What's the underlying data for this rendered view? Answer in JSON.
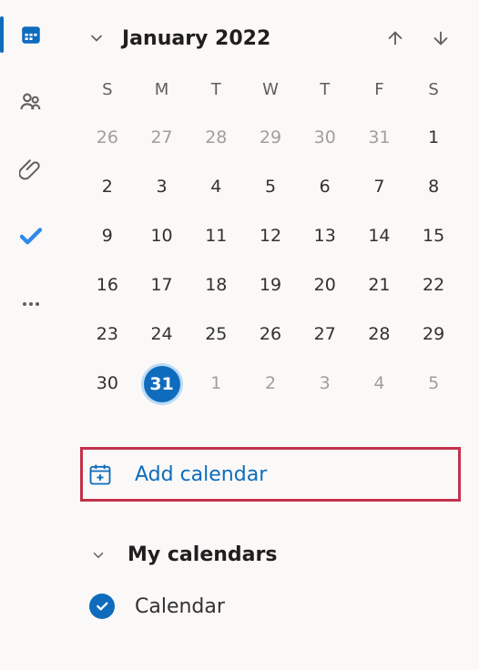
{
  "colors": {
    "accent": "#0f6cbd",
    "highlight": "#c4314b"
  },
  "rail": {
    "items": [
      {
        "name": "calendar",
        "active": true
      },
      {
        "name": "people",
        "active": false
      },
      {
        "name": "files",
        "active": false
      },
      {
        "name": "todo",
        "active": false
      },
      {
        "name": "more",
        "active": false
      }
    ]
  },
  "calendar": {
    "title": "January 2022",
    "dow": [
      "S",
      "M",
      "T",
      "W",
      "T",
      "F",
      "S"
    ],
    "weeks": [
      [
        {
          "d": "26",
          "adj": true
        },
        {
          "d": "27",
          "adj": true
        },
        {
          "d": "28",
          "adj": true
        },
        {
          "d": "29",
          "adj": true
        },
        {
          "d": "30",
          "adj": true
        },
        {
          "d": "31",
          "adj": true
        },
        {
          "d": "1"
        }
      ],
      [
        {
          "d": "2"
        },
        {
          "d": "3"
        },
        {
          "d": "4"
        },
        {
          "d": "5"
        },
        {
          "d": "6"
        },
        {
          "d": "7"
        },
        {
          "d": "8"
        }
      ],
      [
        {
          "d": "9"
        },
        {
          "d": "10"
        },
        {
          "d": "11"
        },
        {
          "d": "12"
        },
        {
          "d": "13"
        },
        {
          "d": "14"
        },
        {
          "d": "15"
        }
      ],
      [
        {
          "d": "16"
        },
        {
          "d": "17"
        },
        {
          "d": "18"
        },
        {
          "d": "19"
        },
        {
          "d": "20"
        },
        {
          "d": "21"
        },
        {
          "d": "22"
        }
      ],
      [
        {
          "d": "23"
        },
        {
          "d": "24"
        },
        {
          "d": "25"
        },
        {
          "d": "26"
        },
        {
          "d": "27"
        },
        {
          "d": "28"
        },
        {
          "d": "29"
        }
      ],
      [
        {
          "d": "30"
        },
        {
          "d": "31",
          "today": true
        },
        {
          "d": "1",
          "adj": true
        },
        {
          "d": "2",
          "adj": true
        },
        {
          "d": "3",
          "adj": true
        },
        {
          "d": "4",
          "adj": true
        },
        {
          "d": "5",
          "adj": true
        }
      ]
    ]
  },
  "actions": {
    "add_calendar_label": "Add calendar"
  },
  "groups": {
    "my_calendars_label": "My calendars",
    "items": [
      {
        "label": "Calendar",
        "checked": true
      }
    ]
  }
}
